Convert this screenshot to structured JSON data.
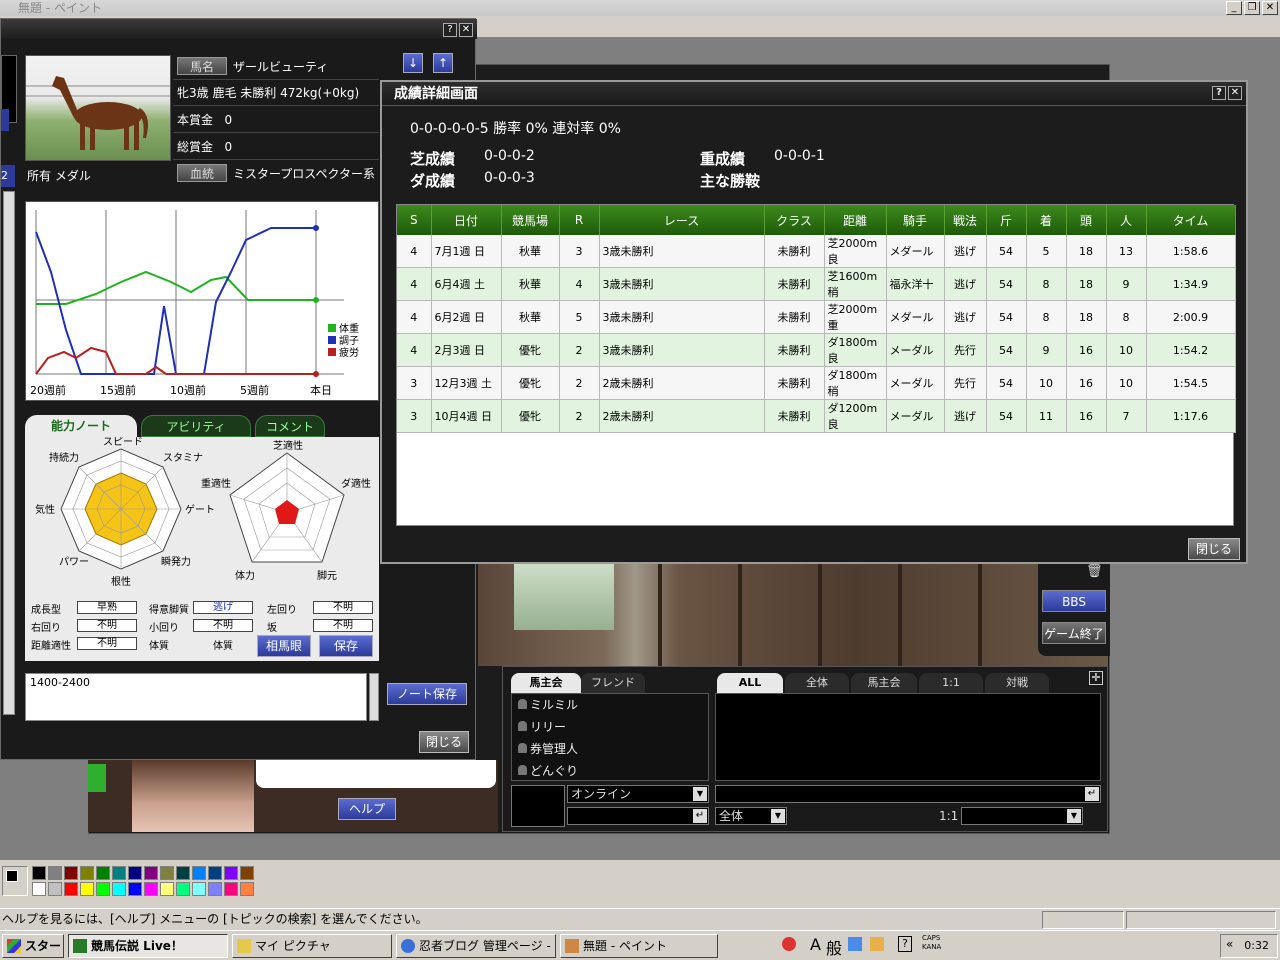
{
  "paint": {
    "title": "無題 - ペイント",
    "status": "ヘルプを見るには、[ヘルプ] メニューの [トピックの検索] を選んでください。"
  },
  "horse": {
    "name_label": "馬名",
    "name": "ザールビューティ",
    "profile": "牝3歳 鹿毛 未勝利 472kg(+0kg)",
    "prize_label": "本賞金",
    "prize": "0",
    "total_label": "総賞金",
    "total": "0",
    "owner": "所有 メダル",
    "bloodline_label": "血統",
    "bloodline": "ミスタープロスペクター系",
    "sort_down": "↓",
    "sort_up": "↑",
    "left_edge_label": "2"
  },
  "chart_data": {
    "type": "line",
    "categories": [
      "20週前",
      "15週前",
      "10週前",
      "5週前",
      "本日"
    ],
    "series": [
      {
        "name": "体重",
        "color": "#21b221"
      },
      {
        "name": "調子",
        "color": "#1f2fb8"
      },
      {
        "name": "疲労",
        "color": "#b81f1f"
      }
    ],
    "legend": "bottom-right",
    "grid": true
  },
  "notebook": {
    "tabs": [
      "能力ノート",
      "アビリティ",
      "コメント"
    ],
    "radar_left_labels": [
      "スピード",
      "スタミナ",
      "ゲート",
      "瞬発力",
      "根性",
      "パワー",
      "気性",
      "持続力"
    ],
    "radar_right_labels": [
      "芝適性",
      "ダ適性",
      "脚元",
      "体力",
      "重適性"
    ],
    "stats": [
      {
        "label": "成長型",
        "value": "早熟"
      },
      {
        "label": "得意脚質",
        "value": "逃げ"
      },
      {
        "label": "左回り",
        "value": "不明"
      },
      {
        "label": "右回り",
        "value": "不明"
      },
      {
        "label": "小回り",
        "value": "不明"
      },
      {
        "label": "坂",
        "value": "不明"
      },
      {
        "label": "距離適性",
        "value": "不明"
      },
      {
        "label": "体質",
        "value": ""
      },
      {
        "label": "体質",
        "value": ""
      }
    ],
    "soma_btn": "相馬眼",
    "save_btn": "保存"
  },
  "memo": {
    "text": "1400-2400",
    "save_btn": "ノート保存",
    "close_btn": "閉じる"
  },
  "results": {
    "title": "成績詳細画面",
    "summary": "0-0-0-0-0-5  勝率 0%  連対率 0%",
    "turf_label": "芝成績",
    "turf_value": "0-0-0-2",
    "dirt_label": "ダ成績",
    "dirt_value": "0-0-0-3",
    "heavy_label": "重成績",
    "heavy_value": "0-0-0-1",
    "jockey_label": "主な勝鞍",
    "columns": [
      "S",
      "日付",
      "競馬場",
      "R",
      "レース",
      "クラス",
      "距離",
      "騎手",
      "戦法",
      "斤",
      "着",
      "頭",
      "人",
      "タイム"
    ],
    "rows": [
      [
        "4",
        "7月1週 日",
        "秋華",
        "3",
        "3歳未勝利",
        "未勝利",
        "芝2000m良",
        "メダール",
        "逃げ",
        "54",
        "5",
        "18",
        "13",
        "1:58.6"
      ],
      [
        "4",
        "6月4週 土",
        "秋華",
        "4",
        "3歳未勝利",
        "未勝利",
        "芝1600m稍",
        "福永洋十",
        "逃げ",
        "54",
        "8",
        "18",
        "9",
        "1:34.9"
      ],
      [
        "4",
        "6月2週 日",
        "秋華",
        "5",
        "3歳未勝利",
        "未勝利",
        "芝2000m重",
        "メダール",
        "逃げ",
        "54",
        "8",
        "18",
        "8",
        "2:00.9"
      ],
      [
        "4",
        "2月3週 日",
        "優牝",
        "2",
        "3歳未勝利",
        "未勝利",
        "ダ1800m良",
        "メーダル",
        "先行",
        "54",
        "9",
        "16",
        "10",
        "1:54.2"
      ],
      [
        "3",
        "12月3週 土",
        "優牝",
        "2",
        "2歳未勝利",
        "未勝利",
        "ダ1800m稍",
        "メーダル",
        "先行",
        "54",
        "10",
        "16",
        "10",
        "1:54.5"
      ],
      [
        "3",
        "10月4週 日",
        "優牝",
        "2",
        "2歳未勝利",
        "未勝利",
        "ダ1200m良",
        "メーダル",
        "逃げ",
        "54",
        "11",
        "16",
        "7",
        "1:17.6"
      ]
    ],
    "close_btn": "閉じる"
  },
  "game": {
    "bbs_btn": "BBS",
    "end_btn": "ゲーム終了",
    "help_btn": "ヘルプ"
  },
  "chat": {
    "left_tabs": [
      "馬主会",
      "フレンド"
    ],
    "right_tabs": [
      "ALL",
      "全体",
      "馬主会",
      "1:1",
      "対戦"
    ],
    "users": [
      "ミルミル",
      "リリー",
      "券管理人",
      "どんぐり"
    ],
    "status": "オンライン",
    "scope": "全体",
    "one_to_one": "1:1"
  },
  "taskbar": {
    "start": "スタート",
    "tasks": [
      "競馬伝説 Live！",
      "マイ ピクチャ",
      "忍者ブログ 管理ページ - ...",
      "無題 - ペイント"
    ],
    "ime": "般",
    "ime_a": "A",
    "caps": "CAPS",
    "kana": "KANA",
    "clock": "0:32",
    "chevron": "«"
  }
}
